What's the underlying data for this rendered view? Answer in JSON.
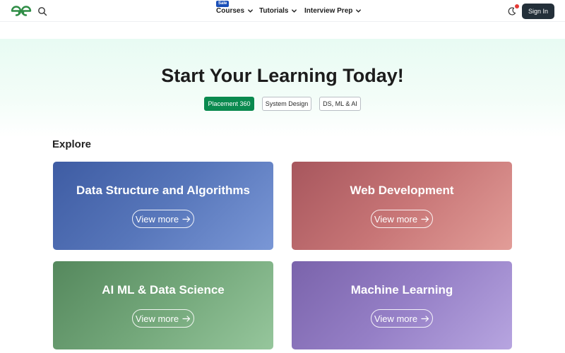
{
  "header": {
    "logo_name": "geeksforgeeks-logo",
    "sale_badge": "Sale",
    "nav": [
      {
        "label": "Courses"
      },
      {
        "label": "Tutorials"
      },
      {
        "label": "Interview Prep"
      }
    ],
    "signin_label": "Sign In"
  },
  "hero": {
    "title": "Start Your Learning Today!",
    "pills": [
      {
        "label": "Placement 360",
        "active": true
      },
      {
        "label": "System Design",
        "active": false
      },
      {
        "label": "DS, ML & AI",
        "active": false
      }
    ]
  },
  "explore": {
    "heading": "Explore",
    "cards": [
      {
        "title": "Data Structure and Algorithms",
        "cta": "View more"
      },
      {
        "title": "Web Development",
        "cta": "View more"
      },
      {
        "title": "AI ML & Data Science",
        "cta": "View more"
      },
      {
        "title": "Machine Learning",
        "cta": "View more"
      }
    ]
  },
  "colors": {
    "accent_green": "#0a8a4f",
    "signin_bg": "#24303a",
    "sale_badge": "#1a4fb8",
    "notification_dot": "#e53935"
  }
}
